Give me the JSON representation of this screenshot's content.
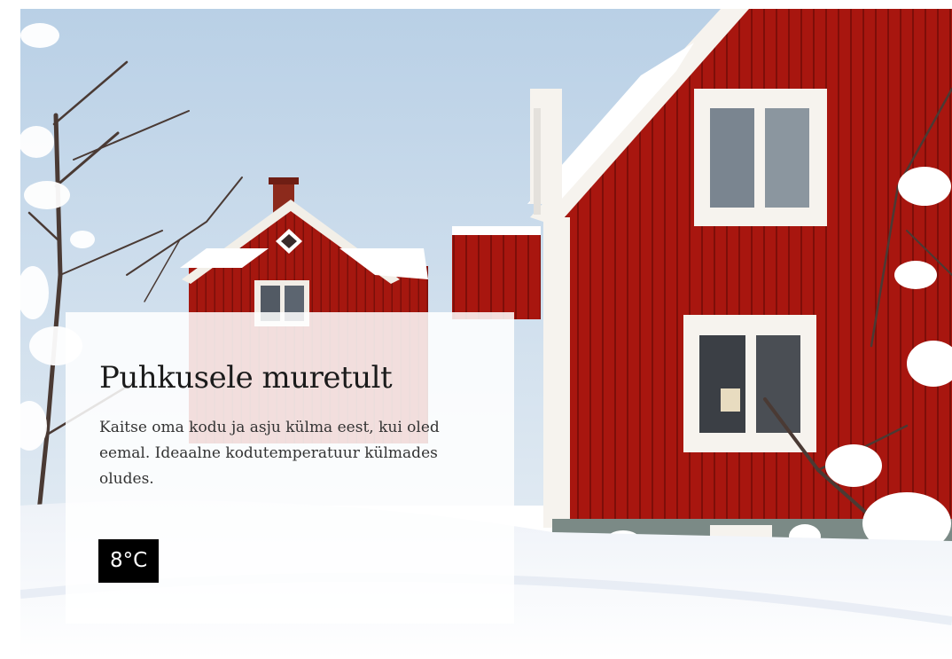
{
  "hero": {
    "title": "Puhkusele muretult",
    "description": "Kaitse oma kodu ja asju külma eest, kui oled eemal. Ideaalne kodutemperatuur külmades oludes.",
    "temperature": "8°C"
  },
  "colors": {
    "sky": "#c4d8ea",
    "barn_red": "#a5150f",
    "trim_white": "#f6f3ee",
    "snow": "#f4f6fa",
    "badge_bg": "#000000"
  },
  "image_elements": [
    "sky",
    "red-house",
    "distant-red-house",
    "snowy-trees",
    "snow-ground"
  ]
}
